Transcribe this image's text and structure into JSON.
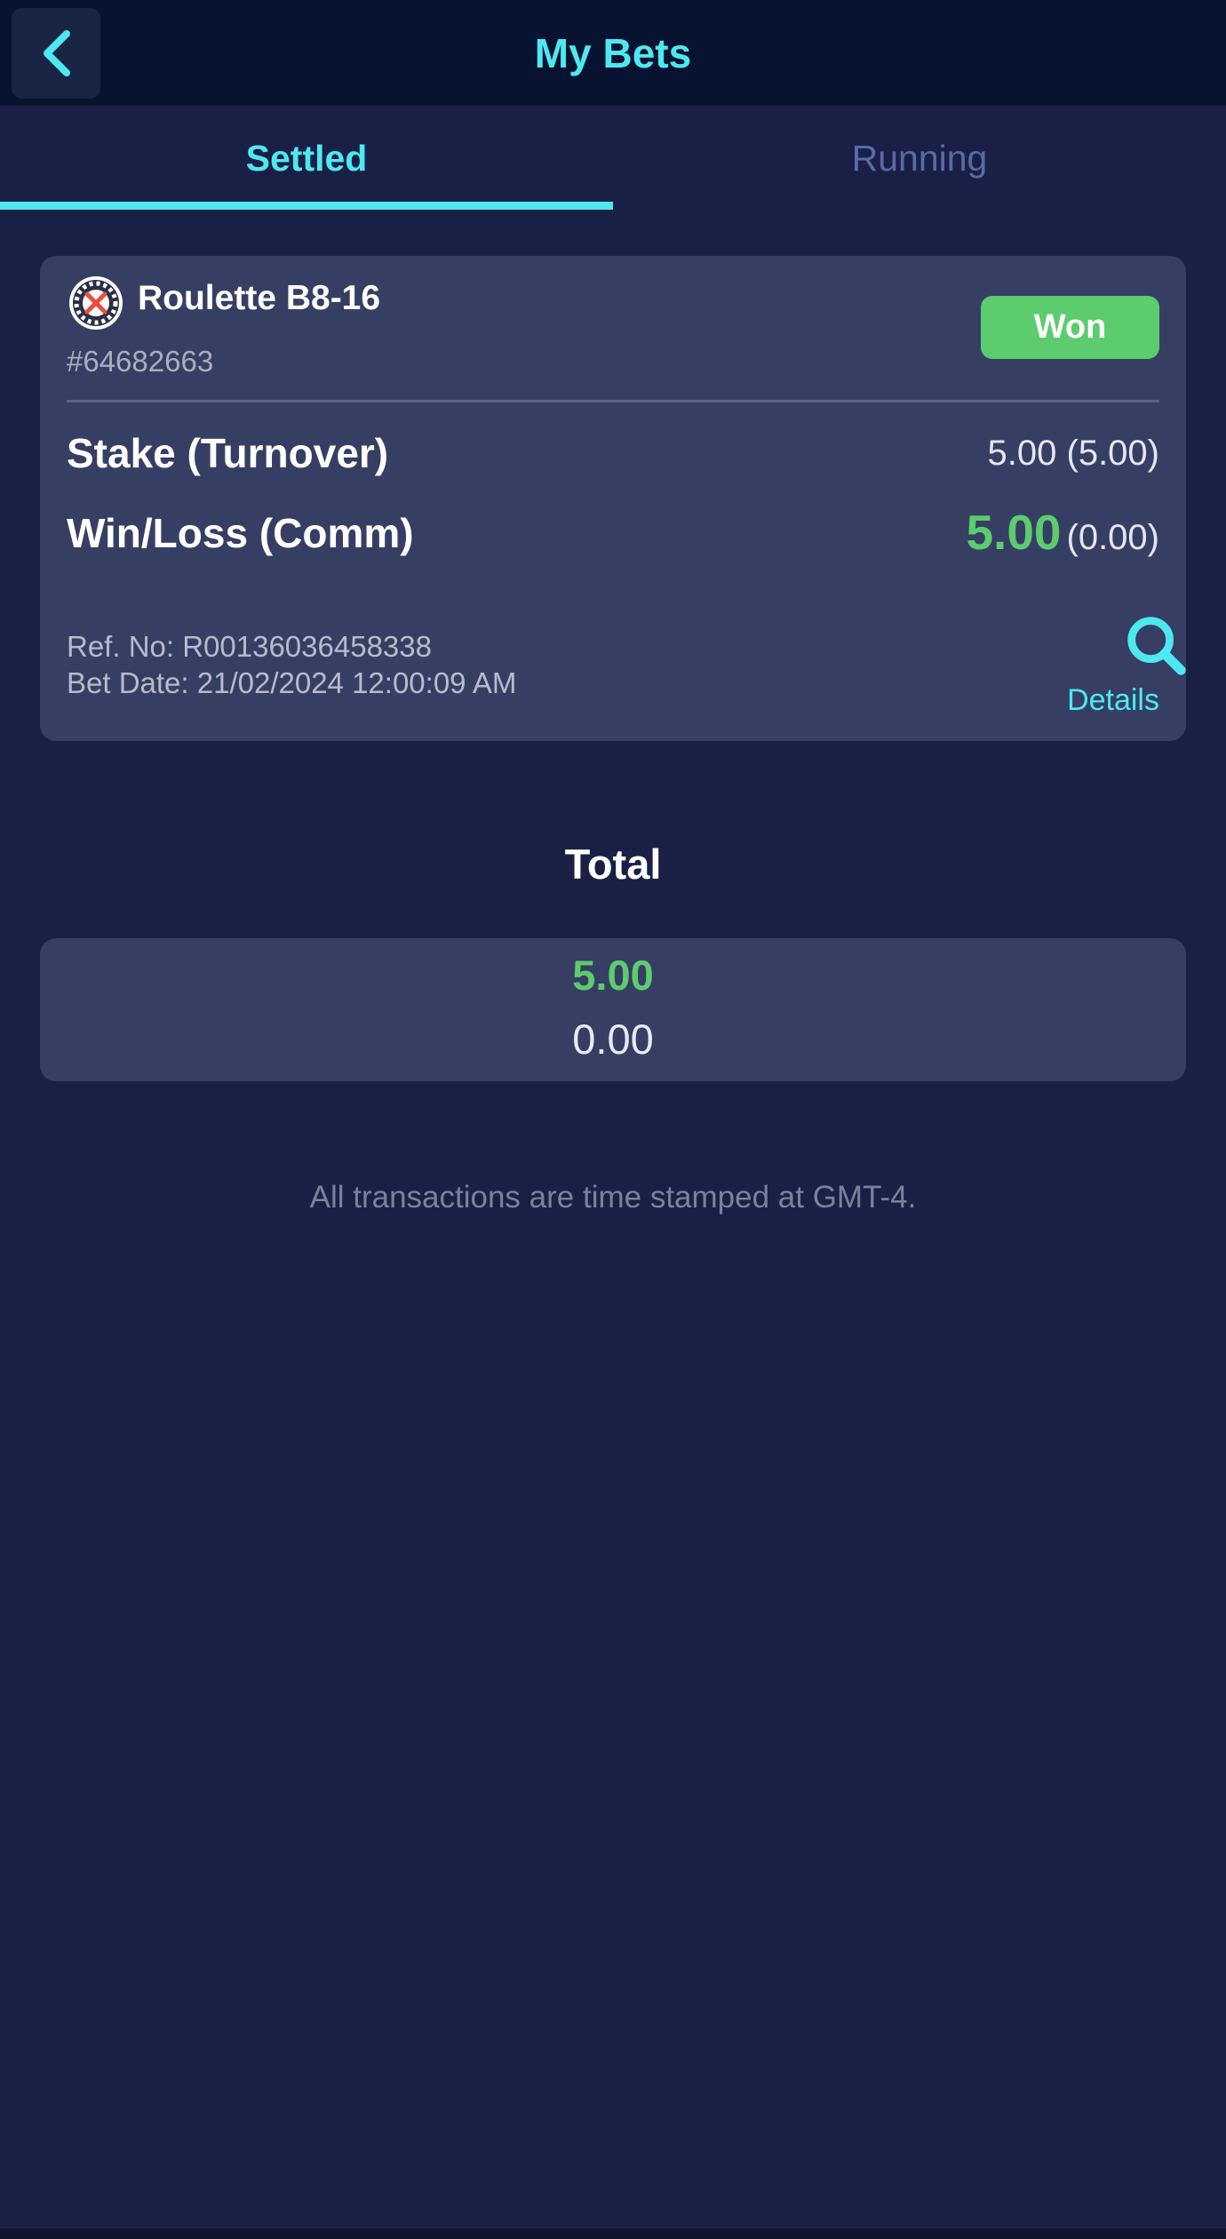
{
  "header": {
    "title": "My Bets",
    "back_icon": "chevron-left-icon"
  },
  "tabs": [
    {
      "label": "Settled",
      "active": true
    },
    {
      "label": "Running",
      "active": false
    }
  ],
  "bet": {
    "game_icon": "roulette-wheel-icon",
    "game_name": "Roulette B8-16",
    "bet_id": "#64682663",
    "status": "Won",
    "stake_label": "Stake (Turnover)",
    "stake_value": "5.00 (5.00)",
    "winloss_label": "Win/Loss (Comm)",
    "winloss_amount": "5.00",
    "winloss_comm": "(0.00)",
    "ref_no": "Ref. No: R00136036458338",
    "bet_date": "Bet Date: 21/02/2024 12:00:09 AM",
    "details_icon": "search-icon",
    "details_label": "Details"
  },
  "total": {
    "title": "Total",
    "winloss": "5.00",
    "comm": "0.00"
  },
  "footnote": "All transactions are time stamped at GMT-4.",
  "colors": {
    "accent": "#4ee8f0",
    "won": "#5ccc6e",
    "background": "#1a2045",
    "card": "#363f63",
    "header": "#071330"
  }
}
